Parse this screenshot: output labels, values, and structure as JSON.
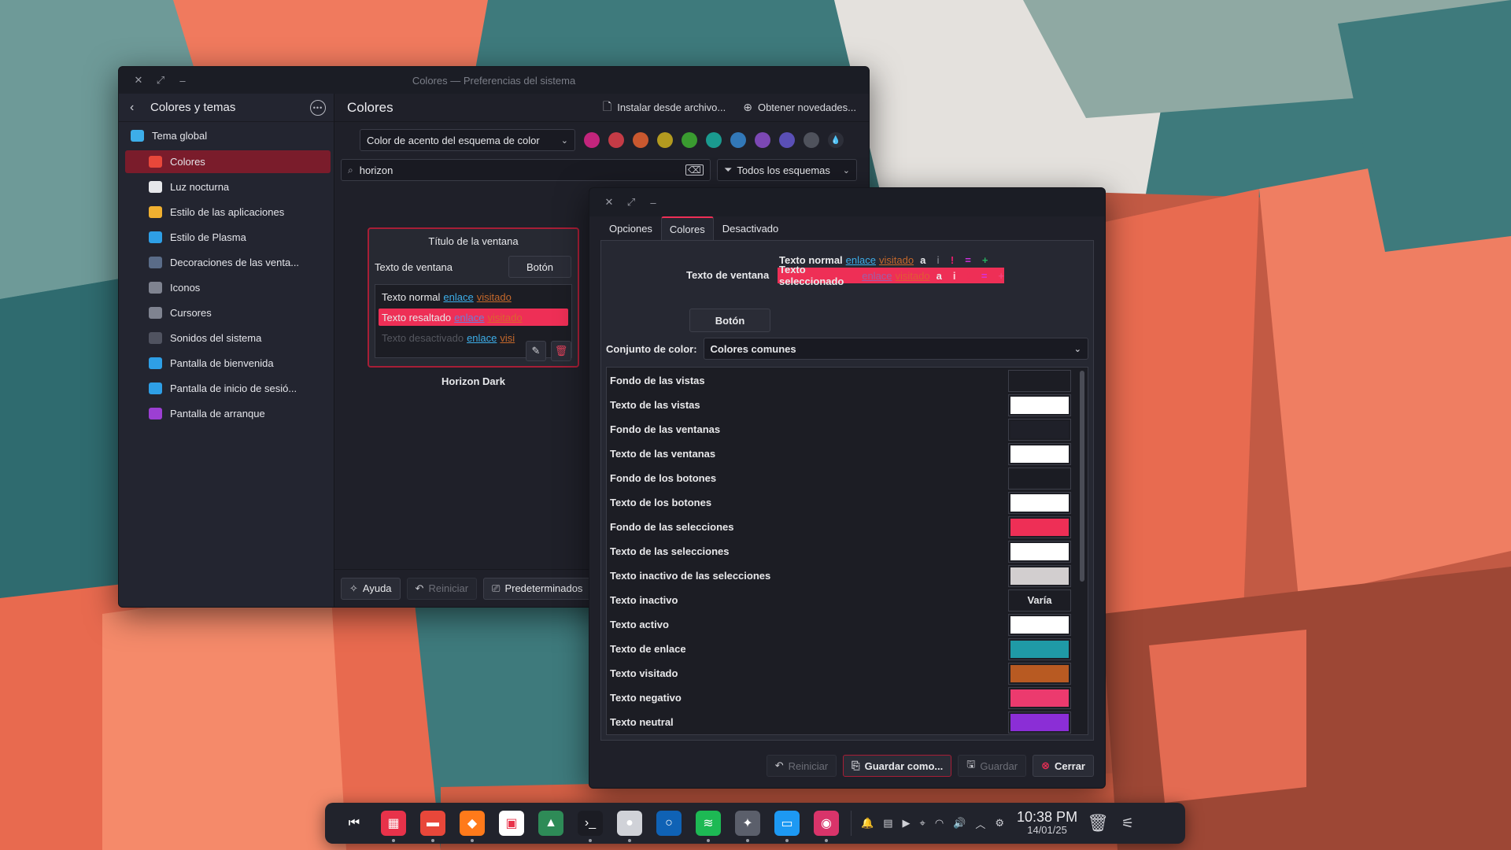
{
  "main_window": {
    "title": "Colores — Preferencias del sistema",
    "sidebar": {
      "title": "Colores y temas",
      "items": [
        {
          "label": "Tema global",
          "icon": "global-theme-icon",
          "color": "#3daee9"
        },
        {
          "label": "Colores",
          "icon": "colors-icon",
          "color": "#e8473a",
          "active": true
        },
        {
          "label": "Luz nocturna",
          "icon": "night-light-icon",
          "color": "#e6e7ea"
        },
        {
          "label": "Estilo de las aplicaciones",
          "icon": "app-style-icon",
          "color": "#f0b030"
        },
        {
          "label": "Estilo de Plasma",
          "icon": "plasma-style-icon",
          "color": "#2e9fe6"
        },
        {
          "label": "Decoraciones de las venta...",
          "icon": "window-decorations-icon",
          "color": "#5a6c88"
        },
        {
          "label": "Iconos",
          "icon": "icons-icon",
          "color": "#7f8390"
        },
        {
          "label": "Cursores",
          "icon": "cursors-icon",
          "color": "#7f8390"
        },
        {
          "label": "Sonidos del sistema",
          "icon": "sounds-icon",
          "color": "#505360"
        },
        {
          "label": "Pantalla de bienvenida",
          "icon": "splash-icon",
          "color": "#2e9fe6"
        },
        {
          "label": "Pantalla de inicio de sesió...",
          "icon": "login-screen-icon",
          "color": "#2e9fe6"
        },
        {
          "label": "Pantalla de arranque",
          "icon": "boot-screen-icon",
          "color": "#9c3fd3"
        }
      ]
    },
    "content": {
      "title": "Colores",
      "install_label": "Instalar desde archivo...",
      "get_new_label": "Obtener novedades...",
      "accent_combo": "Color de acento del esquema de color",
      "accent_swatches": [
        "#c2257c",
        "#c43b46",
        "#c9582f",
        "#b39a1f",
        "#3a9b30",
        "#1a9a8f",
        "#3278b8",
        "#7c48b4",
        "#5a4fb6",
        "#4f525c"
      ],
      "search": {
        "value": "horizon"
      },
      "filter_label": "Todos los esquemas",
      "scheme_card": {
        "window_title": "Título de la ventana",
        "window_text": "Texto de ventana",
        "button": "Botón",
        "normal_text": "Texto normal",
        "highlight_text": "Texto resaltado",
        "disabled_text": "Texto desactivado",
        "link": "enlace",
        "visited": "visitado",
        "visited_short": "visi"
      },
      "scheme_name": "Horizon Dark",
      "bottom": {
        "help": "Ayuda",
        "reset": "Reiniciar",
        "defaults": "Predeterminados"
      }
    }
  },
  "dialog": {
    "tabs": [
      "Opciones",
      "Colores",
      "Desactivado"
    ],
    "active_tab": 1,
    "preview": {
      "window_text": "Texto de ventana",
      "normal_text": "Texto normal",
      "selected_text": "Texto seleccionado",
      "link": "enlace",
      "visited": "visitado",
      "a": "a",
      "i": "i",
      "neg": "!",
      "neu": "=",
      "pos": "+",
      "button": "Botón"
    },
    "color_set_label": "Conjunto de color:",
    "color_set_value": "Colores comunes",
    "colors": [
      {
        "name": "Fondo de las vistas",
        "value": "#1c1d24"
      },
      {
        "name": "Texto de las vistas",
        "value": "#ffffff"
      },
      {
        "name": "Fondo de las ventanas",
        "value": "#1f2029"
      },
      {
        "name": "Texto de las ventanas",
        "value": "#ffffff"
      },
      {
        "name": "Fondo de los botones",
        "value": "#1b1c23"
      },
      {
        "name": "Texto de los botones",
        "value": "#ffffff"
      },
      {
        "name": "Fondo de las selecciones",
        "value": "#ee2f56"
      },
      {
        "name": "Texto de las selecciones",
        "value": "#ffffff"
      },
      {
        "name": "Texto inactivo de las selecciones",
        "value": "#d2cecf"
      },
      {
        "name": "Texto inactivo",
        "value": "",
        "varies": "Varía"
      },
      {
        "name": "Texto activo",
        "value": "#ffffff"
      },
      {
        "name": "Texto de enlace",
        "value": "#1f9aa6"
      },
      {
        "name": "Texto visitado",
        "value": "#b85a22"
      },
      {
        "name": "Texto negativo",
        "value": "#ec3a6e"
      },
      {
        "name": "Texto neutral",
        "value": "#8b2ed6"
      }
    ],
    "footer": {
      "reset": "Reiniciar",
      "save_as": "Guardar como...",
      "save": "Guardar",
      "close": "Cerrar"
    }
  },
  "taskbar": {
    "apps": [
      {
        "name": "kickoff-icon",
        "color": "transparent",
        "glyph": "⏮"
      },
      {
        "name": "app-launcher-icon",
        "color": "#e8324a",
        "glyph": "▦",
        "running": true
      },
      {
        "name": "file-manager-icon",
        "color": "#e8473a",
        "glyph": "▬",
        "running": true
      },
      {
        "name": "firefox-icon",
        "color": "#ff7a1a",
        "glyph": "◆",
        "running": true
      },
      {
        "name": "software-store-icon",
        "color": "#ffffff",
        "glyph": "▣"
      },
      {
        "name": "image-viewer-icon",
        "color": "#2e8b57",
        "glyph": "▲"
      },
      {
        "name": "terminal-icon",
        "color": "#1b1c23",
        "glyph": "›_",
        "running": true
      },
      {
        "name": "recorder-icon",
        "color": "#d0d2d8",
        "glyph": "●",
        "running": true
      },
      {
        "name": "mail-icon",
        "color": "#0f62b5",
        "glyph": "○"
      },
      {
        "name": "spotify-icon",
        "color": "#1db954",
        "glyph": "≋",
        "running": true
      },
      {
        "name": "inkscape-icon",
        "color": "#5b5f6b",
        "glyph": "✦",
        "running": true
      },
      {
        "name": "system-settings-icon",
        "color": "#1d99f3",
        "glyph": "▭",
        "running": true
      },
      {
        "name": "color-picker-icon",
        "color": "#d9346a",
        "glyph": "◉",
        "running": true
      }
    ],
    "tray_icons": [
      "notifications-icon",
      "clipboard-icon",
      "media-icon",
      "location-icon",
      "wifi-icon",
      "volume-icon",
      "expand-tray-icon",
      "settings-gear-icon"
    ],
    "time": "10:38 PM",
    "date": "14/01/25"
  }
}
